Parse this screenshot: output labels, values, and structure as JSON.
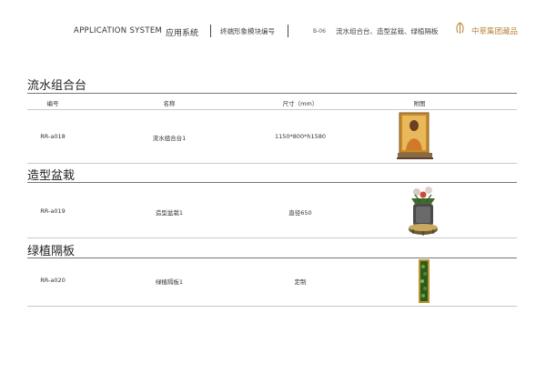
{
  "header": {
    "system_en": "APPLICATION SYSTEM",
    "system_cn": "应用系统",
    "subtitle": "终端形象模块编号",
    "page_code": "B-06",
    "page_title": "流水组合台、造型盆栽、绿植隔板",
    "brand": "中草集团藏品",
    "brand_color": "#b8873e"
  },
  "table_headers": {
    "code": "编号",
    "name": "名称",
    "size": "尺寸（mm）",
    "image": "附图"
  },
  "sections": [
    {
      "title": "流水组合台",
      "code": "RR-a018",
      "name": "流水组合台1",
      "size": "1150*800*h1580",
      "image_icon": "display-stand-photo-icon"
    },
    {
      "title": "造型盆栽",
      "code": "RR-a019",
      "name": "造型盆栽1",
      "size": "直径650",
      "image_icon": "potted-plant-photo-icon"
    },
    {
      "title": "绿植隔板",
      "code": "RR-a020",
      "name": "绿植隔板1",
      "size": "定制",
      "image_icon": "green-partition-photo-icon"
    }
  ]
}
